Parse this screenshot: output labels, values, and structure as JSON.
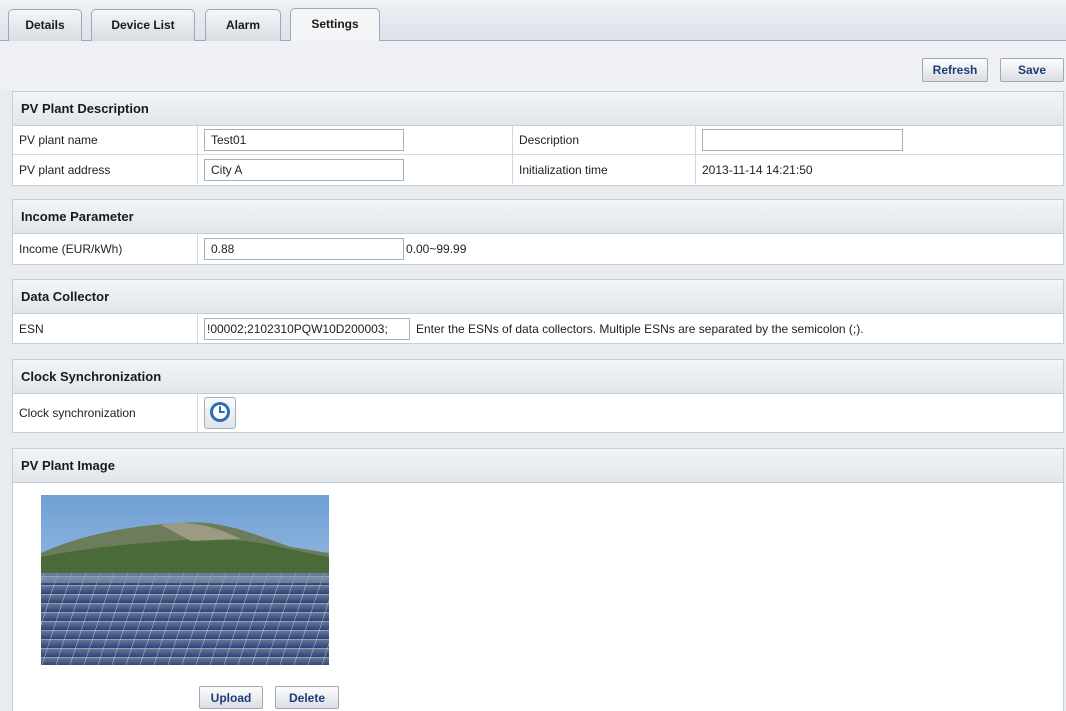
{
  "tabs": [
    {
      "label": "Details"
    },
    {
      "label": "Device List"
    },
    {
      "label": "Alarm"
    },
    {
      "label": "Settings",
      "active": true
    }
  ],
  "toolbar": {
    "refresh_label": "Refresh",
    "save_label": "Save"
  },
  "plant_description": {
    "title": "PV Plant Description",
    "name_label": "PV plant name",
    "name_value": "Test01",
    "description_label": "Description",
    "description_value": "",
    "address_label": "PV plant address",
    "address_value": "City A",
    "init_time_label": "Initialization time",
    "init_time_value": "2013-11-14 14:21:50"
  },
  "income": {
    "title": "Income Parameter",
    "label": "Income (EUR/kWh)",
    "value": "0.88",
    "range": "0.00~99.99"
  },
  "collector": {
    "title": "Data Collector",
    "label": "ESN",
    "value": "!00002;2102310PQW10D200003;",
    "hint": "Enter the ESNs of data collectors. Multiple ESNs are separated by the semicolon (;)."
  },
  "clock": {
    "title": "Clock Synchronization",
    "label": "Clock synchronization",
    "icon": "clock-icon"
  },
  "image": {
    "title": "PV Plant Image",
    "upload_label": "Upload",
    "delete_label": "Delete"
  },
  "colors": {
    "accent": "#1d3e74",
    "clock_blue": "#2a6fb5"
  }
}
